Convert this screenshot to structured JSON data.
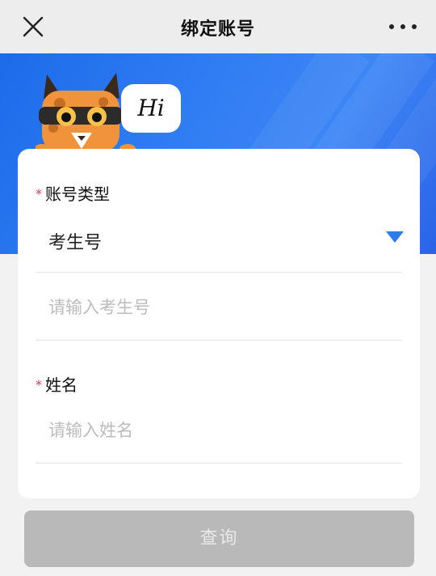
{
  "nav": {
    "title": "绑定账号",
    "close_icon": "close-icon",
    "more_icon": "more-icon"
  },
  "hero": {
    "greeting": "Hi",
    "colors": {
      "gradient_start": "#1e6bea",
      "gradient_end": "#2a63e8"
    }
  },
  "form": {
    "account_type": {
      "label": "账号类型",
      "required_mark": "*",
      "selected_value": "考生号",
      "id_placeholder": "请输入考生号"
    },
    "name": {
      "label": "姓名",
      "required_mark": "*",
      "placeholder": "请输入姓名"
    }
  },
  "actions": {
    "query_label": "查询",
    "query_enabled": false
  },
  "colors": {
    "required": "#e8324d",
    "dropdown_caret": "#2b7cf0",
    "button_disabled": "#b9b9b9"
  }
}
